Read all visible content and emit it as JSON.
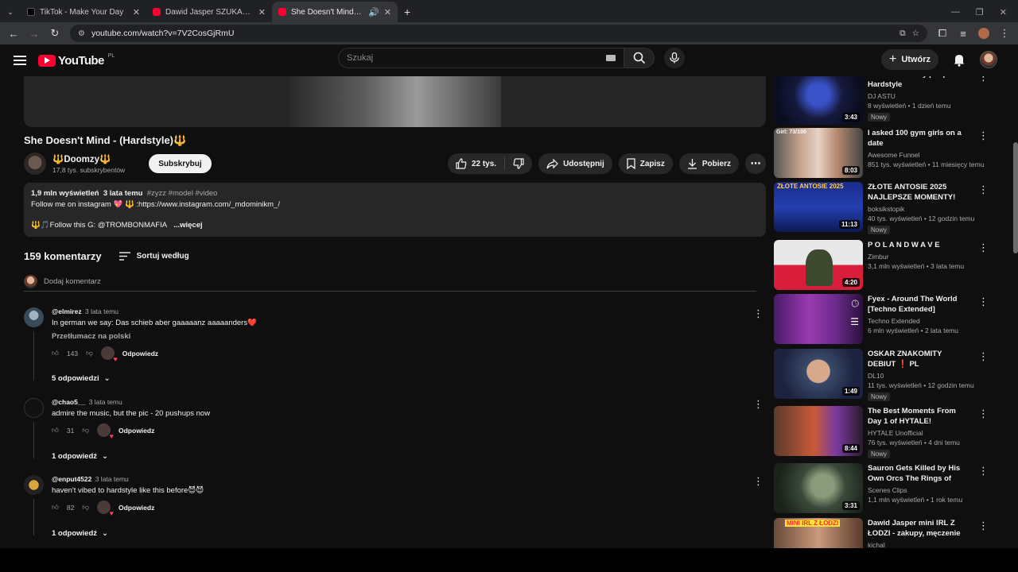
{
  "browser": {
    "tabs": [
      {
        "title": "TikTok - Make Your Day",
        "favicon": "tiktok-icon"
      },
      {
        "title": "Dawid Jasper SZUKANIE MIŁOŚ",
        "favicon": "youtube-icon"
      },
      {
        "title": "She Doesn't Mind - (Hardst",
        "favicon": "youtube-icon"
      }
    ],
    "url": "youtube.com/watch?v=7V2CosGjRmU"
  },
  "header": {
    "logo_text": "YouTube",
    "country": "PL",
    "search_placeholder": "Szukaj",
    "create_label": "Utwórz"
  },
  "video": {
    "title": "She Doesn't Mind - (Hardstyle)🔱",
    "channel": "🔱Doomzy🔱",
    "subscribers": "17,8 tys. subskrybentów",
    "subscribe_label": "Subskrybuj",
    "likes": "22 tys.",
    "share_label": "Udostępnij",
    "save_label": "Zapisz",
    "download_label": "Pobierz"
  },
  "description": {
    "views": "1,9 mln wyświetleń",
    "age": "3 lata temu",
    "tags": "#zyzz #model #video",
    "line1": "Follow me on instagram 💖 🔱 :https://www.instagram.com/_mdominikm_/",
    "line2": "🔱🎵Follow this G:  @TROMBONMAFIA",
    "more": "...więcej"
  },
  "comments": {
    "count": "159 komentarzy",
    "sort_label": "Sortuj według",
    "add_placeholder": "Dodaj komentarz",
    "reply_label": "Odpowiedz",
    "items": [
      {
        "author": "@elmirez",
        "age": "3 lata temu",
        "text": "In german we say: Das schieb aber gaaaaanz aaaaanders❤️",
        "translate": "Przetłumacz na polski",
        "likes": "143",
        "replies": "5 odpowiedzi"
      },
      {
        "author": "@chao5__",
        "age": "3 lata temu",
        "text": "admire the music, but the pic - 20 pushups now",
        "likes": "31",
        "replies": "1 odpowiedź"
      },
      {
        "author": "@enput4522",
        "age": "3 lata temu",
        "text": "haven't vibed to hardstyle like this before😈😈",
        "likes": "82",
        "replies": "1 odpowiedź"
      }
    ]
  },
  "recommendations": [
    {
      "title": "ASTU - Blue Sky | Euphoric Hardstyle",
      "channel": "DJ ASTU",
      "meta": "8 wyświetleń • 1 dzień temu",
      "badge": "Nowy",
      "duration": "3:43"
    },
    {
      "title": "I asked 100 gym girls on a date",
      "channel": "Awesome Funnel",
      "meta": "851 tys. wyświetleń • 11 miesięcy temu",
      "badge": "",
      "duration": "8:03",
      "thumb_text": "Girl: 73/100"
    },
    {
      "title": "ZŁOTE ANTOSIE 2025 NAJLEPSZE MOMENTY!",
      "channel": "boksikstopik",
      "meta": "40 tys. wyświetleń • 12 godzin temu",
      "badge": "Nowy",
      "duration": "11:13",
      "thumb_text": "ZŁOTE ANTOSIE 2025"
    },
    {
      "title": "P O L A N D W A V E",
      "channel": "Zimbur",
      "meta": "3,1 mln wyświetleń • 3 lata temu",
      "badge": "",
      "duration": "4:20"
    },
    {
      "title": "Fyex - Around The World [Techno Extended]",
      "channel": "Techno Extended",
      "meta": "6 mln wyświetleń • 2 lata temu",
      "badge": "",
      "duration": ""
    },
    {
      "title": "OSKAR ZNAKOMITY DEBIUT ❗ PL",
      "channel": "DL10",
      "meta": "11 tys. wyświetleń • 12 godzin temu",
      "badge": "Nowy",
      "duration": "1:49"
    },
    {
      "title": "The Best Moments From Day 1 of HYTALE!",
      "channel": "HYTALE Unofficial",
      "meta": "76 tys. wyświetleń • 4 dni temu",
      "badge": "Nowy",
      "duration": "8:44"
    },
    {
      "title": "Sauron Gets Killed by His Own Orcs The Rings of Power ...",
      "channel": "Scenes Clips",
      "meta": "1,1 mln wyświetleń • 1 rok temu",
      "badge": "",
      "duration": "3:31"
    },
    {
      "title": "Dawid Jasper mini IRL Z ŁODZI - zakupy, męczenie pracowników...",
      "channel": "kichal",
      "meta": "",
      "badge": "",
      "duration": "",
      "thumb_text": "MINI IRL Z ŁODZI"
    }
  ]
}
